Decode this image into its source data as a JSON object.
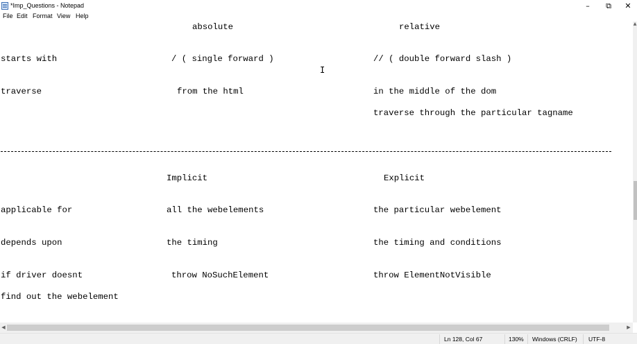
{
  "window": {
    "title": "*Imp_Questions - Notepad",
    "minimize_icon": "minimize-icon",
    "maximize_icon": "restore-icon",
    "close_icon": "close-icon"
  },
  "menu": {
    "file": "File",
    "edit": "Edit",
    "format": "Format",
    "view": "View",
    "help": "Help"
  },
  "editor": {
    "lines": [
      "absolute",
      "relative",
      "starts with",
      "/ ( single forward )",
      "// ( double forward slash )",
      "traverse",
      "from the html",
      "in the middle of the dom",
      "traverse through the particular tagname",
      "Implicit",
      "Explicit",
      "applicable for",
      "all the webelements",
      "the particular webelement",
      "depends upon",
      "the timing",
      "the timing and conditions",
      "if driver doesnt",
      "throw NoSuchElement",
      "throw ElementNotVisible",
      "find out the webelement"
    ],
    "separator": "-------------------------------------------------------------------------------------------------------------------------------",
    "text_cursor_icon": "i-beam-cursor-icon"
  },
  "status": {
    "position": "Ln 128, Col 67",
    "zoom": "130%",
    "line_ending": "Windows (CRLF)",
    "encoding": "UTF-8"
  }
}
